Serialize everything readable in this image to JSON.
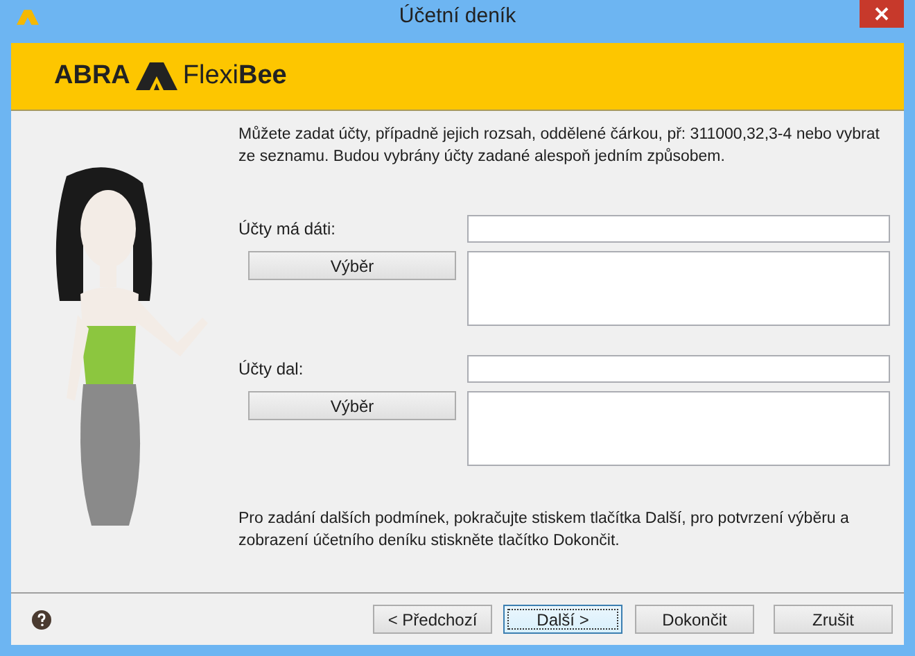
{
  "window": {
    "title": "Účetní deník"
  },
  "banner": {
    "brand": "ABRA",
    "product": "Flexi**Bee**"
  },
  "intro": "Můžete zadat účty, případně jejich rozsah, oddělené čárkou, př: 311000,32,3-4 nebo vybrat ze seznamu. Budou vybrány účty zadané alespoň jedním způsobem.",
  "groups": [
    {
      "label": "Účty má dáti:",
      "button": "Výběr"
    },
    {
      "label": "Účty dal:",
      "button": "Výběr"
    }
  ],
  "hint": "Pro zadání dalších podmínek, pokračujte stiskem tlačítka Další, pro potvrzení výběru a zobrazení účetního deníku stiskněte tlačítko Dokončit.",
  "buttons": [
    {
      "label": "< Předchozí",
      "focused": false
    },
    {
      "label": "Další >",
      "focused": true
    },
    {
      "label": "Dokončit",
      "focused": false
    },
    {
      "label": "Zrušit",
      "focused": false
    }
  ]
}
